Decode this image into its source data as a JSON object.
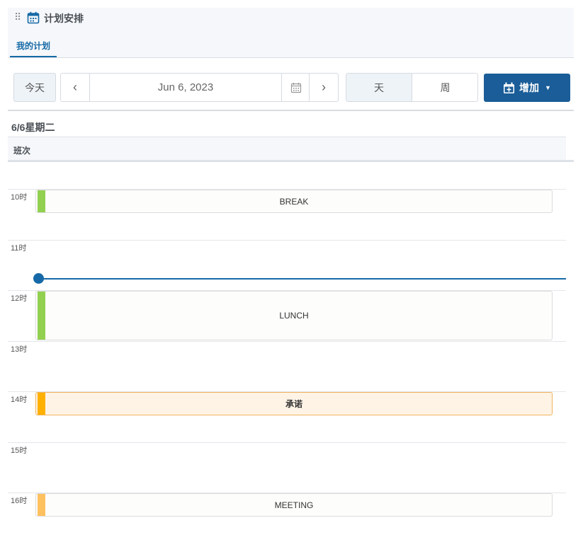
{
  "header": {
    "title": "计划安排",
    "tab": "我的计划"
  },
  "toolbar": {
    "today": "今天",
    "date": "Jun 6, 2023",
    "prev": "‹",
    "next": "›",
    "view_day": "天",
    "view_week": "周",
    "add_label": "增加",
    "add_caret": "▼"
  },
  "day": {
    "label": "6/6星期二",
    "shift_header": "班次"
  },
  "hours": [
    "10时",
    "11时",
    "12时",
    "13时",
    "14时",
    "15时",
    "16时"
  ],
  "events": [
    {
      "label": "BREAK",
      "bar_color": "#92d050"
    },
    {
      "label": "LUNCH",
      "bar_color": "#92d050"
    },
    {
      "label": "承诺",
      "bar_color": "#ffb000"
    },
    {
      "label": "MEETING",
      "bar_color": "#ffc060"
    }
  ],
  "colors": {
    "accent": "#1669a6",
    "add_button": "#1a5d98"
  }
}
